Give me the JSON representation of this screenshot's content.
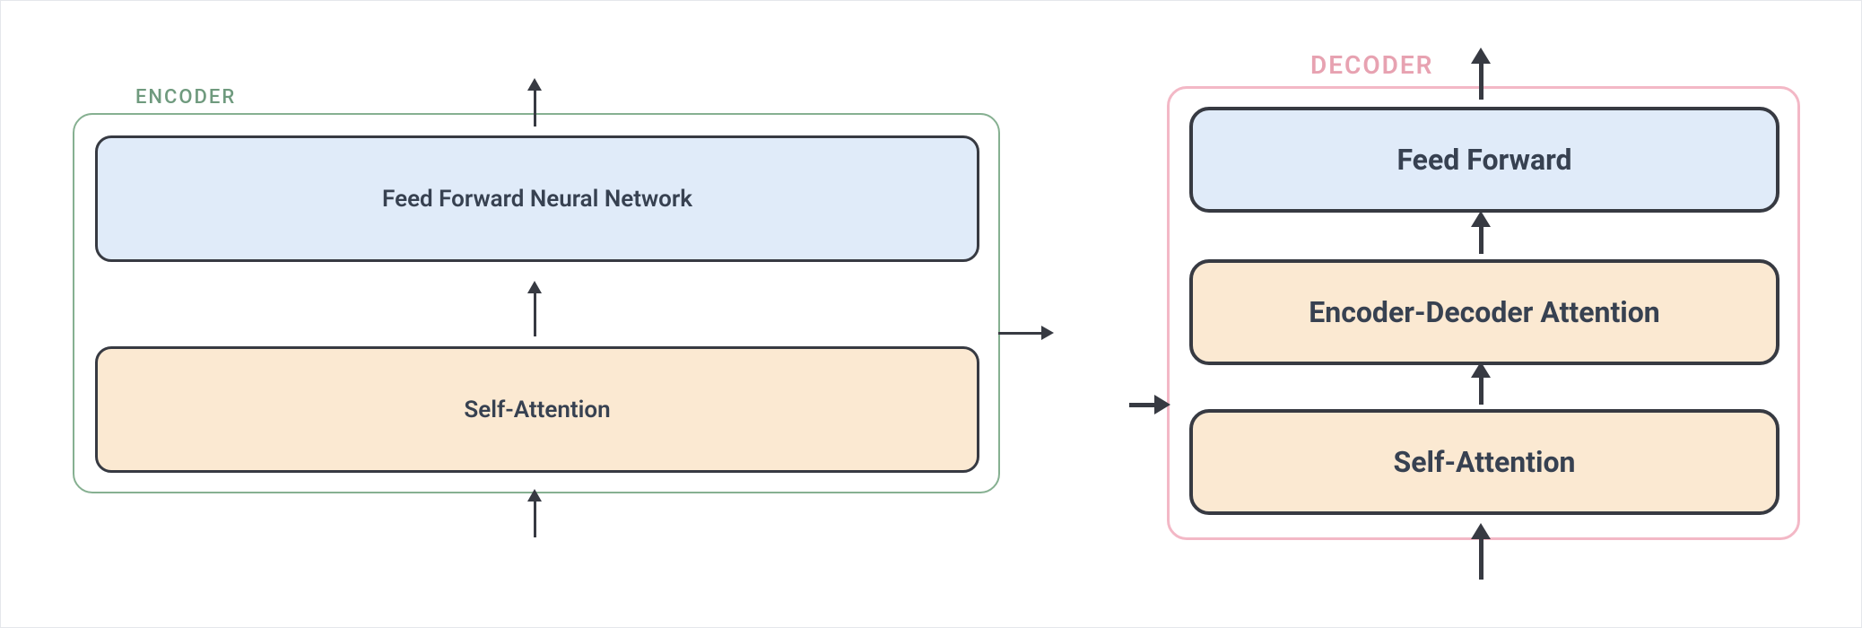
{
  "encoder": {
    "title": "ENCODER",
    "layers": {
      "feed_forward": "Feed Forward Neural Network",
      "self_attention": "Self-Attention"
    }
  },
  "decoder": {
    "title": "DECODER",
    "layers": {
      "feed_forward": "Feed Forward",
      "enc_dec_attention": "Encoder-Decoder Attention",
      "self_attention": "Self-Attention"
    }
  },
  "colors": {
    "encoder_border": "#86b091",
    "decoder_border": "#f3b8c6",
    "block_border": "#373a42",
    "ff_fill": "#e0ebf9",
    "attn_fill": "#fbe9d2"
  }
}
